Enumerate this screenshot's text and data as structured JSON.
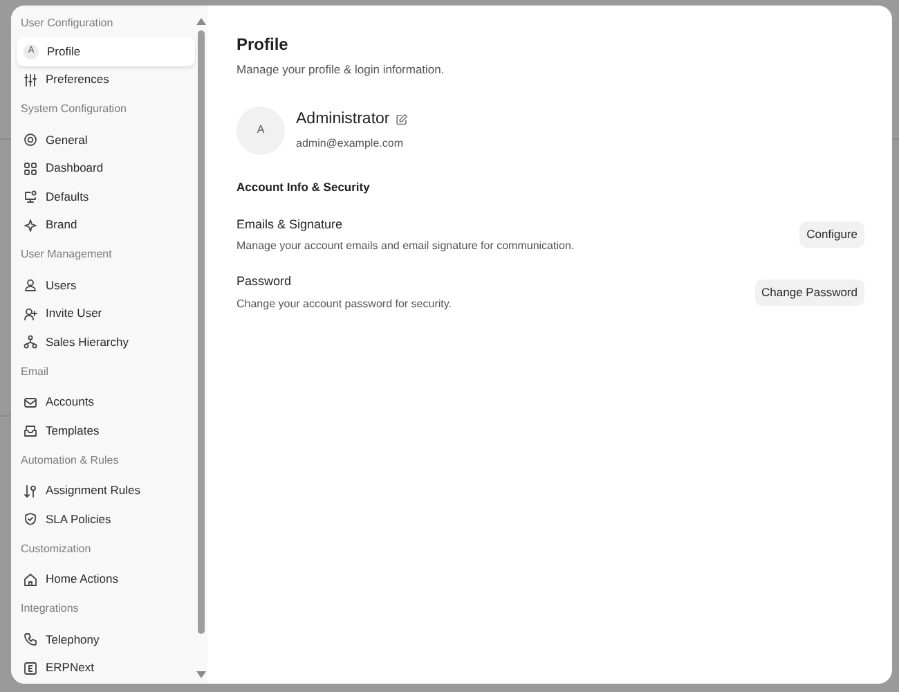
{
  "sidebar": {
    "sections": [
      {
        "title": "User Configuration",
        "items": [
          {
            "label": "Profile",
            "kind": "avatar",
            "avatar_letter": "A",
            "selected": true
          },
          {
            "label": "Preferences",
            "kind": "icon",
            "selected": false
          }
        ]
      },
      {
        "title": "System Configuration",
        "items": [
          {
            "label": "General",
            "kind": "icon",
            "selected": false
          },
          {
            "label": "Dashboard",
            "kind": "icon",
            "selected": false
          },
          {
            "label": "Defaults",
            "kind": "icon",
            "selected": false
          },
          {
            "label": "Brand",
            "kind": "icon",
            "selected": false
          }
        ]
      },
      {
        "title": "User Management",
        "items": [
          {
            "label": "Users",
            "kind": "icon",
            "selected": false
          },
          {
            "label": "Invite User",
            "kind": "icon",
            "selected": false
          },
          {
            "label": "Sales Hierarchy",
            "kind": "icon",
            "selected": false
          }
        ]
      },
      {
        "title": "Email",
        "items": [
          {
            "label": "Accounts",
            "kind": "icon",
            "selected": false
          },
          {
            "label": "Templates",
            "kind": "icon",
            "selected": false
          }
        ]
      },
      {
        "title": "Automation & Rules",
        "items": [
          {
            "label": "Assignment Rules",
            "kind": "icon",
            "selected": false
          },
          {
            "label": "SLA Policies",
            "kind": "icon",
            "selected": false
          }
        ]
      },
      {
        "title": "Customization",
        "items": [
          {
            "label": "Home Actions",
            "kind": "icon",
            "selected": false
          }
        ]
      },
      {
        "title": "Integrations",
        "items": [
          {
            "label": "Telephony",
            "kind": "icon",
            "selected": false
          },
          {
            "label": "ERPNext",
            "kind": "icon",
            "selected": false
          }
        ]
      }
    ]
  },
  "main": {
    "title": "Profile",
    "subtitle": "Manage your profile & login information.",
    "user": {
      "avatar_letter": "A",
      "name": "Administrator",
      "email": "admin@example.com"
    },
    "section_title": "Account Info & Security",
    "rows": [
      {
        "title": "Emails & Signature",
        "description": "Manage your account emails and email signature for communication.",
        "button": "Configure"
      },
      {
        "title": "Password",
        "description": "Change your account password for security.",
        "button": "Change Password"
      }
    ]
  }
}
